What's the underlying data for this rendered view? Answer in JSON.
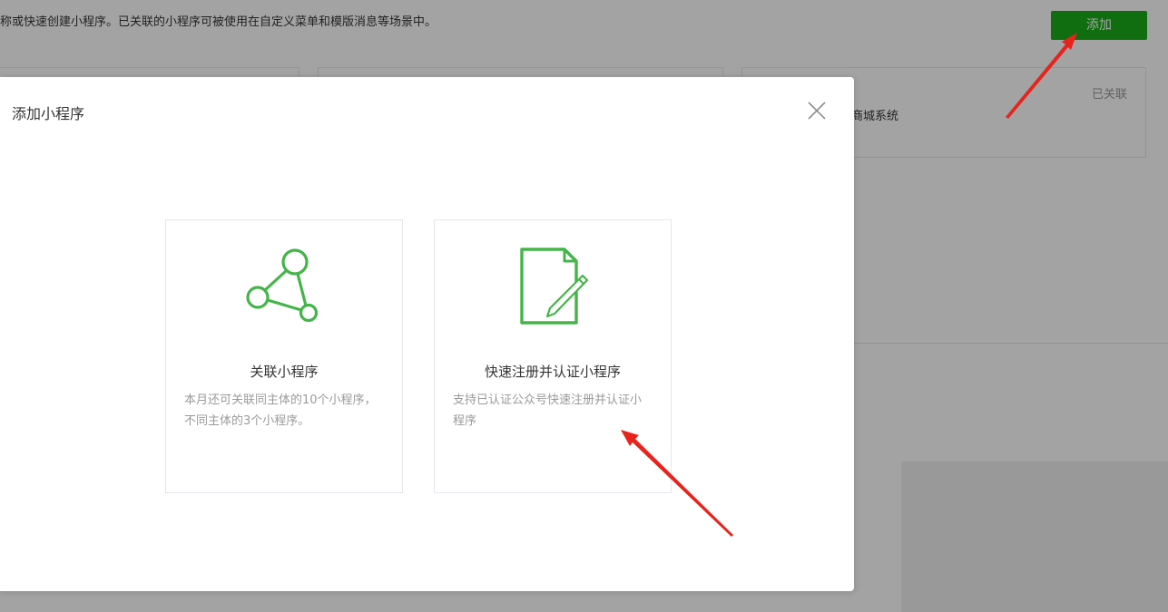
{
  "background": {
    "description": "称或快速创建小程序。已关联的小程序可被使用在自定义菜单和模版消息等场景中。",
    "add_button": "添加",
    "card3": {
      "status": "已关联",
      "name_fragment": "商城系统"
    }
  },
  "dialog": {
    "title": "添加小程序",
    "options": [
      {
        "title": "关联小程序",
        "desc": "本月还可关联同主体的10个小程序，不同主体的3个小程序。",
        "icon": "network-nodes-icon"
      },
      {
        "title": "快速注册并认证小程序",
        "desc": "支持已认证公众号快速注册并认证小程序",
        "icon": "document-pen-icon"
      }
    ]
  },
  "colors": {
    "brand_green": "#1aad19",
    "icon_green": "#44b549",
    "annotation_red": "#e8231b",
    "mask": "rgba(0,0,0,0.36)"
  }
}
